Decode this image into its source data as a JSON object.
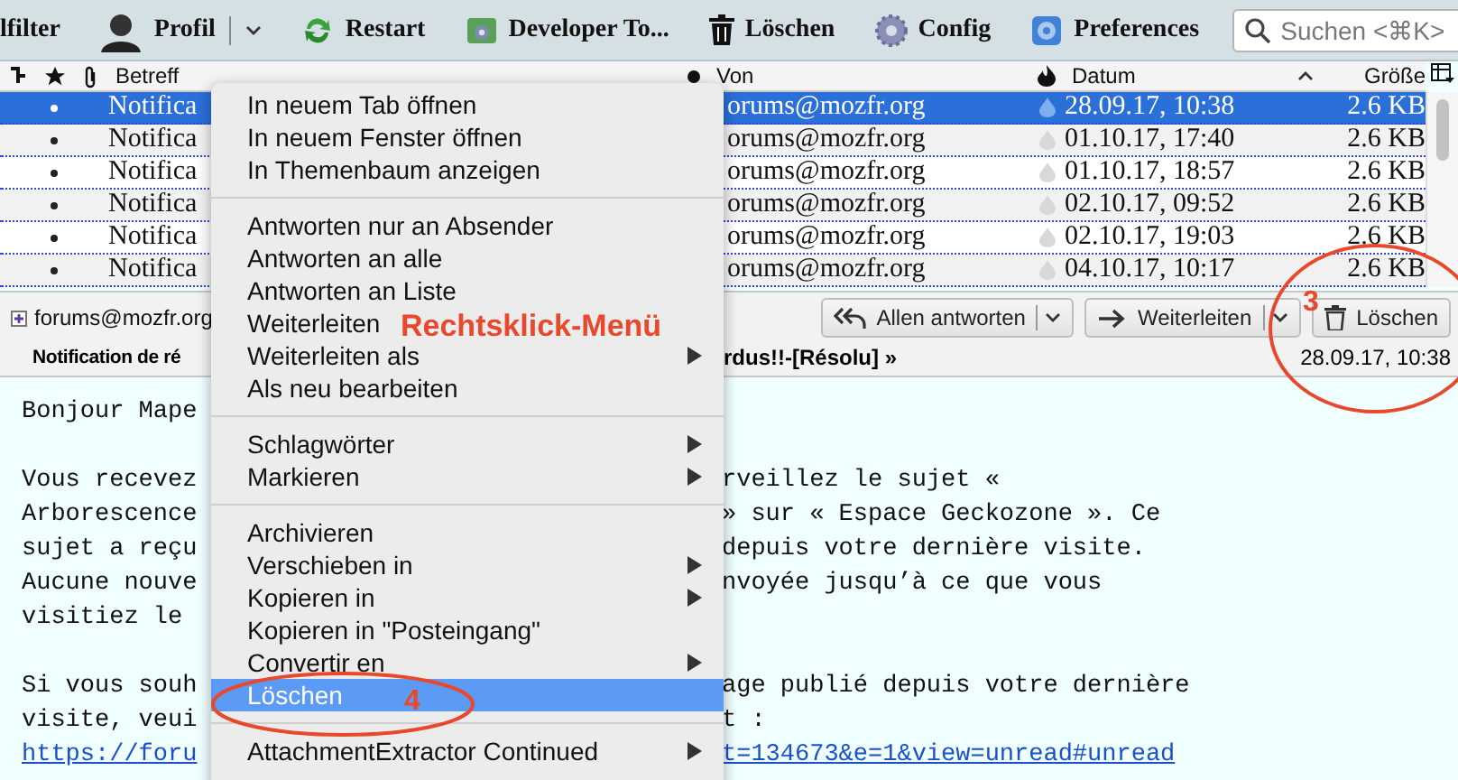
{
  "toolbar": {
    "items": [
      {
        "kind": "text",
        "label": "lfilter"
      },
      {
        "kind": "profile",
        "label": "Profil",
        "dropdown": true
      },
      {
        "kind": "restart",
        "label": "Restart"
      },
      {
        "kind": "devtools",
        "label": "Developer To..."
      },
      {
        "kind": "delete",
        "label": "Löschen"
      },
      {
        "kind": "config",
        "label": "Config"
      },
      {
        "kind": "preferences",
        "label": "Preferences"
      }
    ],
    "search": {
      "placeholder": "Suchen <⌘K>"
    }
  },
  "thread_pane": {
    "columns": [
      "Betreff",
      "Von",
      "Datum",
      "Größe"
    ],
    "rows": [
      {
        "subject": "Notifica",
        "from": "orums@mozfr.org",
        "date": "28.09.17, 10:38",
        "size": "2.6 KB",
        "selected": true
      },
      {
        "subject": "Notifica",
        "from": "orums@mozfr.org",
        "date": "01.10.17, 17:40",
        "size": "2.6 KB",
        "selected": false
      },
      {
        "subject": "Notifica",
        "from": "orums@mozfr.org",
        "date": "01.10.17, 18:57",
        "size": "2.6 KB",
        "selected": false
      },
      {
        "subject": "Notifica",
        "from": "orums@mozfr.org",
        "date": "02.10.17, 09:52",
        "size": "2.6 KB",
        "selected": false
      },
      {
        "subject": "Notifica",
        "from": "orums@mozfr.org",
        "date": "02.10.17, 19:03",
        "size": "2.6 KB",
        "selected": false
      },
      {
        "subject": "Notifica",
        "from": "orums@mozfr.org",
        "date": "04.10.17, 10:17",
        "size": "2.6 KB",
        "selected": false
      }
    ]
  },
  "message": {
    "from": "forums@mozfr.org",
    "subject_start": "Notification de ré",
    "subject_end": "rdus!!-[Résolu] »",
    "date": "28.09.17, 10:38",
    "buttons": [
      {
        "kind": "reply_all",
        "label": "Allen antworten",
        "dropdown": true
      },
      {
        "kind": "forward",
        "label": "Weiterleiten",
        "dropdown": true
      },
      {
        "kind": "delete",
        "label": "Löschen",
        "dropdown": false
      }
    ],
    "body": [
      {
        "kind": "text",
        "left": "Bonjour Mape"
      },
      {
        "kind": "blank"
      },
      {
        "kind": "text",
        "left": "Vous recevez",
        "right": "rveillez le sujet «"
      },
      {
        "kind": "text",
        "left": "Arborescence",
        "right": "» sur « Espace Geckozone ». Ce"
      },
      {
        "kind": "text",
        "left": "sujet a reçu",
        "right": "depuis votre dernière visite."
      },
      {
        "kind": "text",
        "left": "Aucune nouve",
        "right": "nvoyée jusqu’à ce que vous"
      },
      {
        "kind": "text",
        "left": "visitiez le"
      },
      {
        "kind": "blank"
      },
      {
        "kind": "text",
        "left": "Si vous souh",
        "right": "age publié depuis votre dernière"
      },
      {
        "kind": "text",
        "left": "visite, veui",
        "right": "t :"
      },
      {
        "kind": "link",
        "left": "https://foru",
        "right": "t=134673&e=1&view=unread#unread"
      }
    ]
  },
  "context_menu": {
    "items": [
      {
        "kind": "item",
        "label": "In neuem Tab öffnen",
        "submenu": false,
        "selected": false
      },
      {
        "kind": "item",
        "label": "In neuem Fenster öffnen",
        "submenu": false,
        "selected": false
      },
      {
        "kind": "item",
        "label": "In Themenbaum anzeigen",
        "submenu": false,
        "selected": false
      },
      {
        "kind": "separator"
      },
      {
        "kind": "item",
        "label": "Antworten nur an Absender",
        "submenu": false,
        "selected": false
      },
      {
        "kind": "item",
        "label": "Antworten an alle",
        "submenu": false,
        "selected": false
      },
      {
        "kind": "item",
        "label": "Antworten an Liste",
        "submenu": false,
        "selected": false
      },
      {
        "kind": "item",
        "label": "Weiterleiten",
        "submenu": false,
        "selected": false
      },
      {
        "kind": "item",
        "label": "Weiterleiten als",
        "submenu": true,
        "selected": false
      },
      {
        "kind": "item",
        "label": "Als neu bearbeiten",
        "submenu": false,
        "selected": false
      },
      {
        "kind": "separator"
      },
      {
        "kind": "item",
        "label": "Schlagwörter",
        "submenu": true,
        "selected": false
      },
      {
        "kind": "item",
        "label": "Markieren",
        "submenu": true,
        "selected": false
      },
      {
        "kind": "separator"
      },
      {
        "kind": "item",
        "label": "Archivieren",
        "submenu": false,
        "selected": false
      },
      {
        "kind": "item",
        "label": "Verschieben in",
        "submenu": true,
        "selected": false
      },
      {
        "kind": "item",
        "label": "Kopieren in",
        "submenu": true,
        "selected": false
      },
      {
        "kind": "item",
        "label": "Kopieren in \"Posteingang\"",
        "submenu": false,
        "selected": false
      },
      {
        "kind": "item",
        "label": "Convertir en",
        "submenu": true,
        "selected": false
      },
      {
        "kind": "item",
        "label": "Löschen",
        "submenu": false,
        "selected": true
      },
      {
        "kind": "separator"
      },
      {
        "kind": "item",
        "label": "AttachmentExtractor Continued",
        "submenu": true,
        "selected": false
      }
    ]
  },
  "annotations": {
    "title": "Rechtsklick-Menü",
    "markers": [
      "3",
      "4"
    ]
  }
}
